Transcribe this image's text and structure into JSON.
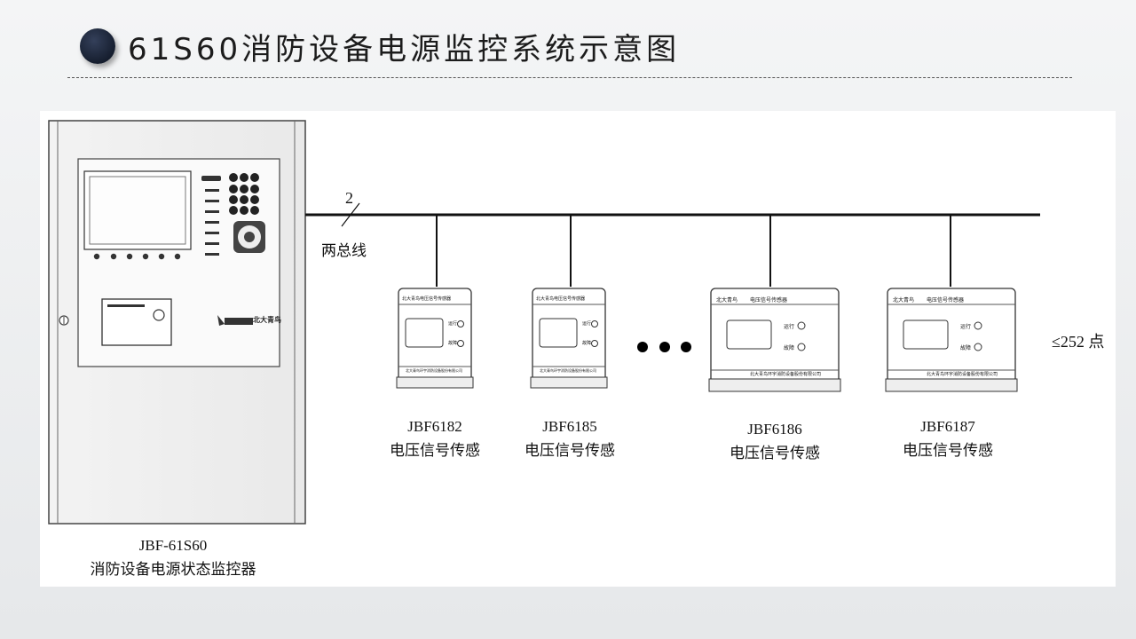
{
  "header": {
    "title": "61S60消防设备电源监控系统示意图"
  },
  "diagram": {
    "bus": {
      "wire_count": "2",
      "label": "两总线"
    },
    "controller": {
      "model": "JBF-61S60",
      "name": "消防设备电源状态监控器",
      "logo_text": "北大青鸟"
    },
    "sensors": [
      {
        "model": "JBF6182",
        "name": "电压信号传感",
        "panel_title": "电压信号传感器",
        "run_label": "运行",
        "fault_label": "故障",
        "maker": "北大青鸟环宇消防设备股份有限公司",
        "logo": "北大青鸟"
      },
      {
        "model": "JBF6185",
        "name": "电压信号传感",
        "panel_title": "电压信号传感器",
        "run_label": "运行",
        "fault_label": "故障",
        "maker": "北大青鸟环宇消防设备股份有限公司",
        "logo": "北大青鸟"
      },
      {
        "model": "JBF6186",
        "name": "电压信号传感",
        "panel_title": "电压信号传感器",
        "run_label": "运行",
        "fault_label": "故障",
        "maker": "北大青鸟环宇消防设备股份有限公司",
        "logo": "北大青鸟"
      },
      {
        "model": "JBF6187",
        "name": "电压信号传感",
        "panel_title": "电压信号传感器",
        "run_label": "运行",
        "fault_label": "故障",
        "maker": "北大青鸟环宇消防设备股份有限公司",
        "logo": "北大青鸟"
      }
    ],
    "capacity": "≤252 点"
  }
}
